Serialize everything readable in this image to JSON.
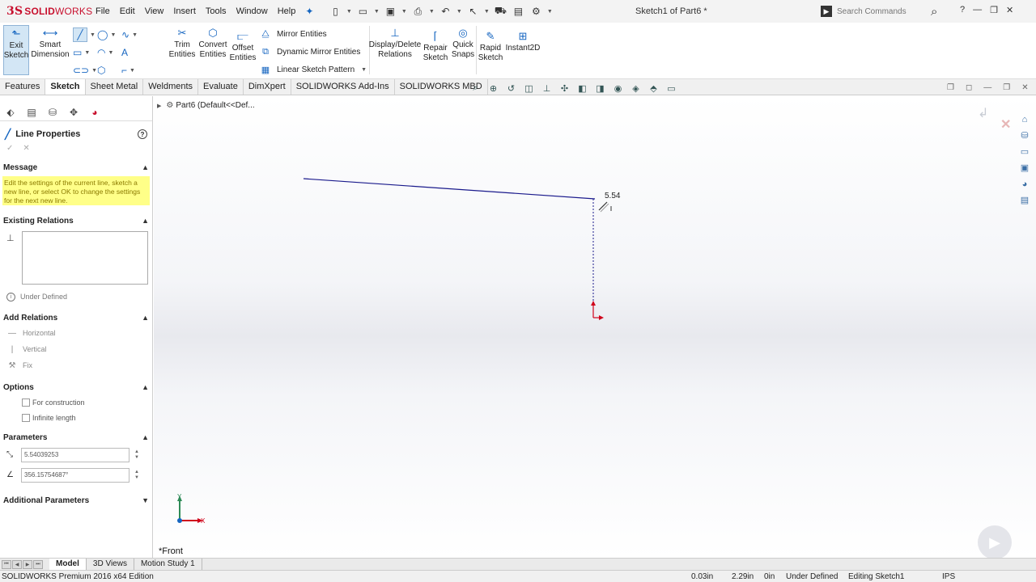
{
  "app": {
    "logo_prefix": "3S",
    "logo_solid": "SOLID",
    "logo_works": "WORKS",
    "menu": [
      "File",
      "Edit",
      "View",
      "Insert",
      "Tools",
      "Window",
      "Help"
    ],
    "document_title": "Sketch1 of Part6 *",
    "search_placeholder": "Search Commands",
    "help_label": "?"
  },
  "commands": {
    "exit_sketch": "Exit\nSketch",
    "smart_dimension": "Smart\nDimension",
    "trim_entities": "Trim\nEntities",
    "convert_entities": "Convert\nEntities",
    "offset_entities": "Offset\nEntities",
    "mirror_entities": "Mirror Entities",
    "dynamic_mirror_entities": "Dynamic Mirror Entities",
    "linear_sketch_pattern": "Linear Sketch Pattern",
    "display_delete_relations": "Display/Delete\nRelations",
    "repair_sketch": "Repair\nSketch",
    "quick_snaps": "Quick\nSnaps",
    "rapid_sketch": "Rapid\nSketch",
    "instant2d": "Instant2D"
  },
  "tabs": [
    "Features",
    "Sketch",
    "Sheet Metal",
    "Weldments",
    "Evaluate",
    "DimXpert",
    "SOLIDWORKS Add-Ins",
    "SOLIDWORKS MBD"
  ],
  "active_tab": "Sketch",
  "property_manager": {
    "title": "Line Properties",
    "message_header": "Message",
    "message_text": "Edit the settings of the current line, sketch a new line, or select OK to change the settings for the next new line.",
    "existing_relations_header": "Existing Relations",
    "status": "Under Defined",
    "add_relations_header": "Add Relations",
    "relations": [
      "Horizontal",
      "Vertical",
      "Fix"
    ],
    "options_header": "Options",
    "options": [
      "For construction",
      "Infinite length"
    ],
    "parameters_header": "Parameters",
    "length_value": "5.54039253",
    "angle_value": "356.15754687°",
    "additional_header": "Additional Parameters"
  },
  "graphics": {
    "tree_label": "Part6  (Default<<Def...",
    "dimension_label": "5.54",
    "view_label": "*Front",
    "axis_x": "X",
    "axis_y": "Y"
  },
  "bottom_tabs": [
    "Model",
    "3D Views",
    "Motion Study 1"
  ],
  "status_bar": {
    "edition": "SOLIDWORKS Premium 2016 x64 Edition",
    "x": "0.03in",
    "y": "2.29in",
    "z": "0in",
    "state": "Under Defined",
    "editing": "Editing Sketch1",
    "units": "IPS"
  },
  "colors": {
    "brand": "#c8102e",
    "accent": "#1565c0",
    "message_bg": "#ffff88",
    "sketch_line": "#1a1a8c",
    "origin": "#d0021b"
  }
}
